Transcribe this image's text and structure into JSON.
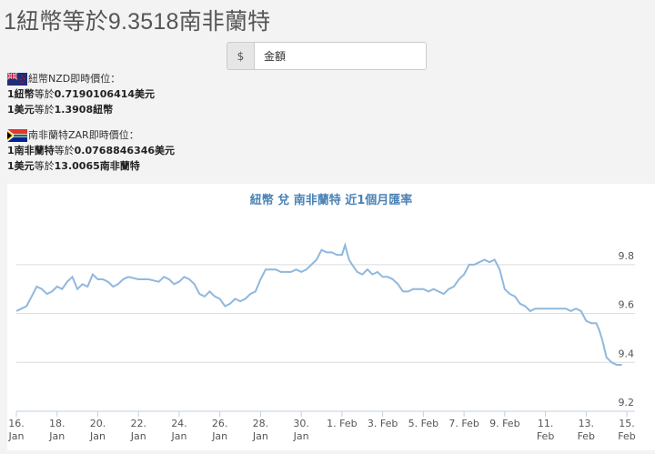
{
  "page_title": "1紐幣等於9.3518南非蘭特",
  "converter": {
    "currency_symbol": "$",
    "amount_placeholder": "金額"
  },
  "rates": [
    {
      "flag": "nz-flag-icon",
      "heading": "紐幣NZD即時價位：",
      "lines": [
        {
          "bold": "1紐幣",
          "plain": "等於",
          "value": "0.7190106414美元"
        },
        {
          "bold": "1美元",
          "plain": "等於",
          "value": "1.3908紐幣"
        }
      ]
    },
    {
      "flag": "za-flag-icon",
      "heading": "南非蘭特ZAR即時價位：",
      "lines": [
        {
          "bold": "1南非蘭特",
          "plain": "等於",
          "value": "0.0768846346美元"
        },
        {
          "bold": "1美元",
          "plain": "等於",
          "value": "13.0065南非蘭特"
        }
      ]
    }
  ],
  "chart_data": {
    "type": "line",
    "title": "紐幣 兌 南非蘭特 近1個月匯率",
    "ylim": [
      9.2,
      9.9
    ],
    "yticks": [
      9.2,
      9.4,
      9.6,
      9.8
    ],
    "grid": true,
    "line_color": "#8fb8de",
    "title_color": "#4a82b5",
    "xticks": [
      {
        "x": 0,
        "line1": "16.",
        "line2": "Jan"
      },
      {
        "x": 4,
        "line1": "18.",
        "line2": "Jan"
      },
      {
        "x": 8,
        "line1": "20.",
        "line2": "Jan"
      },
      {
        "x": 12,
        "line1": "22.",
        "line2": "Jan"
      },
      {
        "x": 16,
        "line1": "24.",
        "line2": "Jan"
      },
      {
        "x": 20,
        "line1": "26.",
        "line2": "Jan"
      },
      {
        "x": 24,
        "line1": "28.",
        "line2": "Jan"
      },
      {
        "x": 28,
        "line1": "30.",
        "line2": "Jan"
      },
      {
        "x": 32,
        "line1": "1. Feb",
        "line2": ""
      },
      {
        "x": 36,
        "line1": "3. Feb",
        "line2": ""
      },
      {
        "x": 40,
        "line1": "5. Feb",
        "line2": ""
      },
      {
        "x": 44,
        "line1": "7. Feb",
        "line2": ""
      },
      {
        "x": 48,
        "line1": "9. Feb",
        "line2": ""
      },
      {
        "x": 52,
        "line1": "11.",
        "line2": "Feb"
      },
      {
        "x": 56,
        "line1": "13.",
        "line2": "Feb"
      },
      {
        "x": 60,
        "line1": "15.",
        "line2": "Feb"
      }
    ],
    "xmax": 60.8,
    "series": [
      {
        "values": [
          [
            0,
            9.61
          ],
          [
            0.5,
            9.62
          ],
          [
            1,
            9.63
          ],
          [
            1.5,
            9.67
          ],
          [
            2,
            9.71
          ],
          [
            2.5,
            9.7
          ],
          [
            3,
            9.68
          ],
          [
            3.5,
            9.69
          ],
          [
            4,
            9.71
          ],
          [
            4.5,
            9.7
          ],
          [
            5,
            9.73
          ],
          [
            5.5,
            9.75
          ],
          [
            6,
            9.7
          ],
          [
            6.5,
            9.72
          ],
          [
            7,
            9.71
          ],
          [
            7.5,
            9.76
          ],
          [
            8,
            9.74
          ],
          [
            8.5,
            9.74
          ],
          [
            9,
            9.73
          ],
          [
            9.5,
            9.71
          ],
          [
            10,
            9.72
          ],
          [
            10.5,
            9.74
          ],
          [
            11,
            9.75
          ],
          [
            12,
            9.74
          ],
          [
            13,
            9.74
          ],
          [
            14,
            9.73
          ],
          [
            14.5,
            9.75
          ],
          [
            15,
            9.74
          ],
          [
            15.5,
            9.72
          ],
          [
            16,
            9.73
          ],
          [
            16.5,
            9.75
          ],
          [
            17,
            9.74
          ],
          [
            17.5,
            9.72
          ],
          [
            18,
            9.68
          ],
          [
            18.5,
            9.67
          ],
          [
            19,
            9.69
          ],
          [
            19.5,
            9.67
          ],
          [
            20,
            9.66
          ],
          [
            20.5,
            9.63
          ],
          [
            21,
            9.64
          ],
          [
            21.5,
            9.66
          ],
          [
            22,
            9.65
          ],
          [
            22.5,
            9.66
          ],
          [
            23,
            9.68
          ],
          [
            23.5,
            9.69
          ],
          [
            24,
            9.74
          ],
          [
            24.5,
            9.78
          ],
          [
            25,
            9.78
          ],
          [
            25.5,
            9.78
          ],
          [
            26,
            9.77
          ],
          [
            27,
            9.77
          ],
          [
            27.5,
            9.78
          ],
          [
            28,
            9.77
          ],
          [
            28.5,
            9.78
          ],
          [
            29,
            9.8
          ],
          [
            29.5,
            9.82
          ],
          [
            30,
            9.86
          ],
          [
            30.5,
            9.85
          ],
          [
            31,
            9.85
          ],
          [
            31.5,
            9.84
          ],
          [
            32,
            9.84
          ],
          [
            32.3,
            9.88
          ],
          [
            32.7,
            9.82
          ],
          [
            33,
            9.8
          ],
          [
            33.5,
            9.77
          ],
          [
            34,
            9.76
          ],
          [
            34.5,
            9.78
          ],
          [
            35,
            9.76
          ],
          [
            35.5,
            9.77
          ],
          [
            36,
            9.75
          ],
          [
            36.5,
            9.75
          ],
          [
            37,
            9.74
          ],
          [
            37.5,
            9.72
          ],
          [
            38,
            9.69
          ],
          [
            38.5,
            9.69
          ],
          [
            39,
            9.7
          ],
          [
            40,
            9.7
          ],
          [
            40.5,
            9.69
          ],
          [
            41,
            9.7
          ],
          [
            41.5,
            9.69
          ],
          [
            42,
            9.68
          ],
          [
            42.5,
            9.7
          ],
          [
            43,
            9.71
          ],
          [
            43.5,
            9.74
          ],
          [
            44,
            9.76
          ],
          [
            44.5,
            9.8
          ],
          [
            45,
            9.8
          ],
          [
            45.5,
            9.81
          ],
          [
            46,
            9.82
          ],
          [
            46.5,
            9.81
          ],
          [
            47,
            9.82
          ],
          [
            47.5,
            9.78
          ],
          [
            48,
            9.7
          ],
          [
            48.5,
            9.68
          ],
          [
            49,
            9.67
          ],
          [
            49.5,
            9.64
          ],
          [
            50,
            9.63
          ],
          [
            50.5,
            9.61
          ],
          [
            51,
            9.62
          ],
          [
            51.5,
            9.62
          ],
          [
            52,
            9.62
          ],
          [
            52.5,
            9.62
          ],
          [
            53,
            9.62
          ],
          [
            54,
            9.62
          ],
          [
            54.5,
            9.61
          ],
          [
            55,
            9.62
          ],
          [
            55.5,
            9.61
          ],
          [
            56,
            9.57
          ],
          [
            56.5,
            9.56
          ],
          [
            57,
            9.56
          ],
          [
            57.3,
            9.53
          ],
          [
            57.6,
            9.49
          ],
          [
            58,
            9.42
          ],
          [
            58.5,
            9.4
          ],
          [
            59,
            9.39
          ],
          [
            59.5,
            9.39
          ]
        ]
      }
    ]
  }
}
